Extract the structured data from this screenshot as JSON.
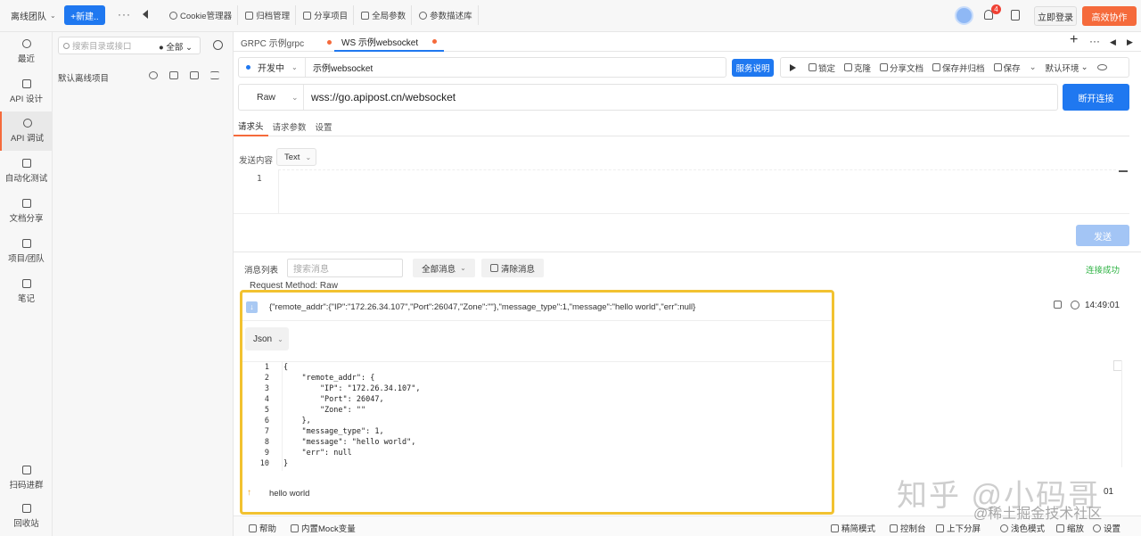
{
  "topbar": {
    "team": "离线团队",
    "new_button": "+新建..",
    "tools": [
      "Cookie管理器",
      "归档管理",
      "分享项目",
      "全局参数",
      "参数描述库"
    ],
    "notification_count": "4",
    "login_button": "立即登录",
    "collab_button": "高效协作"
  },
  "leftnav": {
    "items": [
      {
        "label": "最近",
        "icon": "clock-icon"
      },
      {
        "label": "API 设计",
        "icon": "api-design-icon"
      },
      {
        "label": "API 调试",
        "icon": "api-debug-icon"
      },
      {
        "label": "自动化测试",
        "icon": "automation-icon"
      },
      {
        "label": "文档分享",
        "icon": "doc-share-icon"
      },
      {
        "label": "项目/团队",
        "icon": "project-icon"
      },
      {
        "label": "笔记",
        "icon": "note-icon"
      },
      {
        "label": "扫码进群",
        "icon": "qr-icon"
      },
      {
        "label": "回收站",
        "icon": "trash-icon"
      }
    ]
  },
  "tree": {
    "search_placeholder": "搜索目录或接口",
    "filter": "全部",
    "project": "默认离线项目"
  },
  "tabs": [
    {
      "label": "GRPC 示例grpc"
    },
    {
      "label": "WS 示例websocket"
    }
  ],
  "request": {
    "status": "开发中",
    "name": "示例websocket",
    "service_button": "服务说明",
    "actions": [
      "锁定",
      "克隆",
      "分享文档",
      "保存并归档",
      "保存"
    ],
    "environment": "默认环境",
    "method": "Raw",
    "url": "wss://go.apipost.cn/websocket",
    "connect_button": "断开连接",
    "subtabs": [
      "请求头",
      "请求参数",
      "设置"
    ],
    "send_label": "发送内容",
    "send_type": "Text",
    "editor_line": "1",
    "send_button": "发送"
  },
  "messages": {
    "label": "消息列表",
    "search_placeholder": "搜索消息",
    "filter": "全部消息",
    "clear_button": "清除消息",
    "connection_status": "连接成功",
    "request_method": "Request Method: Raw",
    "received_text": "{\"remote_addr\":{\"IP\":\"172.26.34.107\",\"Port\":26047,\"Zone\":\"\"},\"message_type\":1,\"message\":\"hello world\",\"err\":null}",
    "received_time": "14:49:01",
    "format": "Json",
    "json_lines": [
      "{",
      "    \"remote_addr\": {",
      "        \"IP\": \"172.26.34.107\",",
      "        \"Port\": 26047,",
      "        \"Zone\": \"\"",
      "    },",
      "    \"message_type\": 1,",
      "    \"message\": \"hello world\",",
      "    \"err\": null",
      "}"
    ],
    "sent_text": "hello world",
    "sent_time": "01"
  },
  "footer": {
    "left": [
      "帮助",
      "内置Mock变量"
    ],
    "right": [
      "精简模式",
      "控制台",
      "上下分屏",
      "浅色模式",
      "缩放",
      "设置"
    ]
  },
  "watermark": {
    "main": "知乎 @小码哥",
    "sub": "@稀土掘金技术社区"
  }
}
